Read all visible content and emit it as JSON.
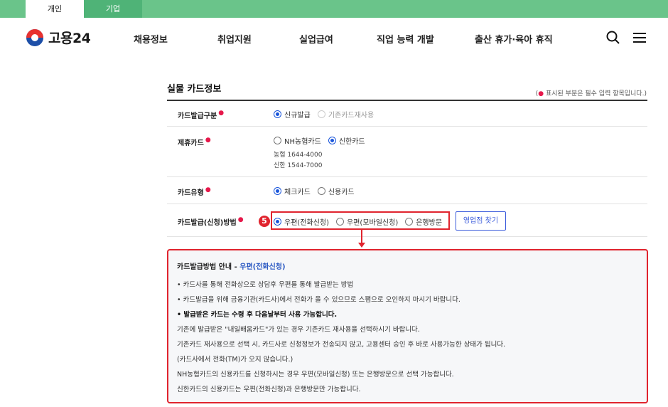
{
  "top_tabs": [
    {
      "label": "개인",
      "active": true
    },
    {
      "label": "기업",
      "active": false
    }
  ],
  "header": {
    "logo_text": "고용24",
    "nav": [
      "채용정보",
      "취업지원",
      "실업급여",
      "직업 능력 개발",
      "출산 휴가·육아 휴직"
    ],
    "icons": [
      "search-icon",
      "menu-icon"
    ]
  },
  "section": {
    "title": "실물 카드정보",
    "required_note_prefix": "(",
    "required_note_dot": "●",
    "required_note_text": " 표시된 부분은 필수 입력 항목입니다.)"
  },
  "form": {
    "required_mark": "●",
    "issue_type": {
      "label": "카드발급구분",
      "options": [
        {
          "label": "신규발급",
          "checked": true,
          "disabled": false
        },
        {
          "label": "기존카드재사용",
          "checked": false,
          "disabled": true
        }
      ]
    },
    "partner_card": {
      "label": "제휴카드",
      "options": [
        {
          "label": "NH농협카드",
          "checked": false
        },
        {
          "label": "신한카드",
          "checked": true
        }
      ],
      "phones": [
        "농협 1644-4000",
        "신한 1544-7000"
      ]
    },
    "card_type": {
      "label": "카드유형",
      "options": [
        {
          "label": "체크카드",
          "checked": true
        },
        {
          "label": "신용카드",
          "checked": false
        }
      ]
    },
    "issue_method": {
      "label": "카드발급(신청)방법",
      "options": [
        {
          "label": "우편(전화신청)",
          "checked": true
        },
        {
          "label": "우편(모바일신청)",
          "checked": false
        },
        {
          "label": "은행방문",
          "checked": false
        }
      ],
      "find_branch_button": "영업점 찾기",
      "step_badge": "5"
    }
  },
  "guide": {
    "title_prefix": "카드발급방법 안내 - ",
    "title_highlight": "우편(전화신청)",
    "lines": [
      {
        "text": "• 카드사를 통해 전화상으로 상담후 우편를 통해 발급받는 방법",
        "bold": false
      },
      {
        "text": "• 카드발급을 위해 금융기관(카드사)에서 전화가 올 수 있으므로 스팸으로 오인하지 마시기 바랍니다.",
        "bold": false
      },
      {
        "text": "• 발급받은 카드는 수령 후 다음날부터 사용 가능합니다.",
        "bold": true
      },
      {
        "text": "기존에 발급받은 \"내일배움카드\"가 있는 경우 기존카드 재사용을 선택하시기 바랍니다.",
        "bold": false
      },
      {
        "text": "기존카드 재사용으로 선택 시, 카드사로 신청정보가 전송되지 않고, 고용센터 승인 후 바로 사용가능한 상태가 됩니다.",
        "bold": false
      },
      {
        "text": "(카드사에서 전화(TM)가 오지 않습니다.)",
        "bold": false
      },
      {
        "text": "NH농협카드의 신용카드를 신청하시는 경우 우편(모바일신청) 또는 은행방문으로 선택 가능합니다.",
        "bold": false
      },
      {
        "text": "신한카드의 신용카드는 우편(전화신청)과 은행방문만 가능합니다.",
        "bold": false
      }
    ]
  },
  "colors": {
    "topbar_green": "#6ac48a",
    "highlight_red": "#e0242e",
    "accent_blue": "#2b59c3"
  }
}
